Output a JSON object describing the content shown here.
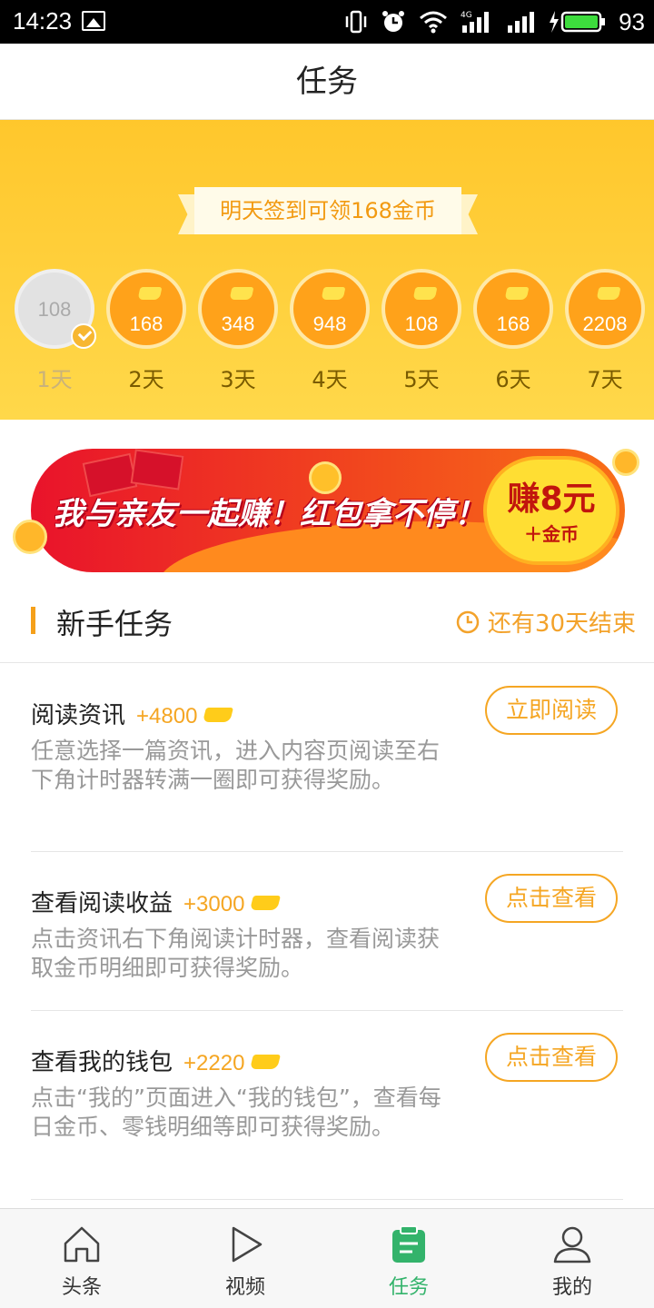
{
  "status_bar": {
    "time": "14:23",
    "battery": "93",
    "network": "4G"
  },
  "header": {
    "title": "任务"
  },
  "signin": {
    "banner_text": "明天签到可领168金币",
    "days": [
      {
        "value": "108",
        "label": "1天",
        "done": true
      },
      {
        "value": "168",
        "label": "2天",
        "done": false
      },
      {
        "value": "348",
        "label": "3天",
        "done": false
      },
      {
        "value": "948",
        "label": "4天",
        "done": false
      },
      {
        "value": "108",
        "label": "5天",
        "done": false
      },
      {
        "value": "168",
        "label": "6天",
        "done": false
      },
      {
        "value": "2208",
        "label": "7天",
        "done": false
      }
    ]
  },
  "promo": {
    "slogan": "我与亲友一起赚！红包拿不停！",
    "cta_main": "赚8元",
    "cta_sub": "＋金币"
  },
  "section": {
    "title": "新手任务",
    "countdown": "还有30天结束"
  },
  "tasks": [
    {
      "name": "阅读资讯",
      "reward": "+4800",
      "desc": "任意选择一篇资讯，进入内容页阅读至右下角计时器转满一圈即可获得奖励。",
      "button": "立即阅读"
    },
    {
      "name": "查看阅读收益",
      "reward": "+3000",
      "desc": "点击资讯右下角阅读计时器，查看阅读获取金币明细即可获得奖励。",
      "button": "点击查看"
    },
    {
      "name": "查看我的钱包",
      "reward": "+2220",
      "desc": "点击“我的”页面进入“我的钱包”，查看每日金币、零钱明细等即可获得奖励。",
      "button": "点击查看"
    }
  ],
  "nav": [
    {
      "label": "头条",
      "icon": "home-icon",
      "active": false
    },
    {
      "label": "视频",
      "icon": "play-icon",
      "active": false
    },
    {
      "label": "任务",
      "icon": "task-clipboard-icon",
      "active": true
    },
    {
      "label": "我的",
      "icon": "user-icon",
      "active": false
    }
  ],
  "colors": {
    "accent": "#f5a623",
    "signin_bg": "#ffcc33",
    "nav_active": "#33b36b",
    "promo_red": "#e9132b"
  }
}
